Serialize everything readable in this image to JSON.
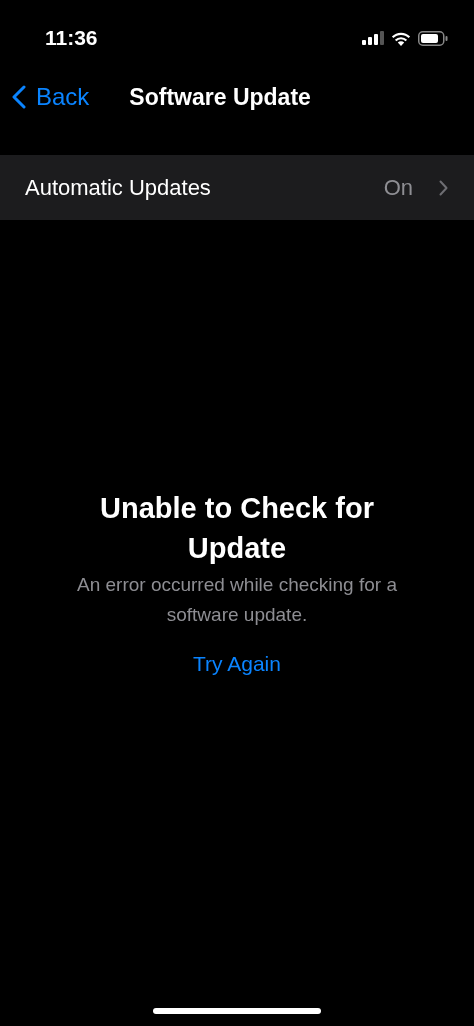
{
  "status_bar": {
    "time": "11:36"
  },
  "nav": {
    "back": "Back",
    "title": "Software Update"
  },
  "settings": [
    {
      "label": "Automatic Updates",
      "value": "On"
    }
  ],
  "message": {
    "title": "Unable to Check for Update",
    "body": "An error occurred while checking for a software update.",
    "action": "Try Again"
  }
}
